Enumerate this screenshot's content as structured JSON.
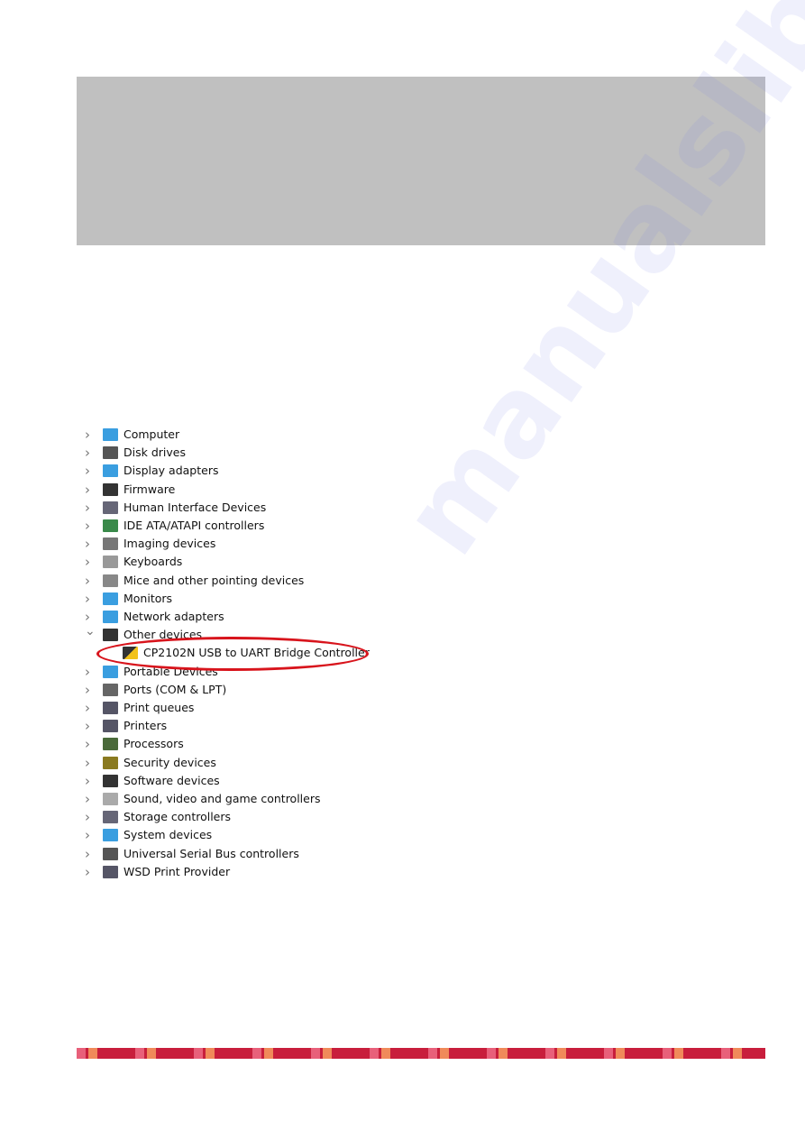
{
  "device_manager": {
    "items": [
      {
        "label": "Computer",
        "icon": "computer-icon",
        "expanded": false
      },
      {
        "label": "Disk drives",
        "icon": "disk-drive-icon",
        "expanded": false
      },
      {
        "label": "Display adapters",
        "icon": "display-adapter-icon",
        "expanded": false
      },
      {
        "label": "Firmware",
        "icon": "firmware-chip-icon",
        "expanded": false
      },
      {
        "label": "Human Interface Devices",
        "icon": "hid-icon",
        "expanded": false
      },
      {
        "label": "IDE ATA/ATAPI controllers",
        "icon": "ide-controller-icon",
        "expanded": false
      },
      {
        "label": "Imaging devices",
        "icon": "camera-icon",
        "expanded": false
      },
      {
        "label": "Keyboards",
        "icon": "keyboard-icon",
        "expanded": false
      },
      {
        "label": "Mice and other pointing devices",
        "icon": "mouse-icon",
        "expanded": false
      },
      {
        "label": "Monitors",
        "icon": "monitor-icon",
        "expanded": false
      },
      {
        "label": "Network adapters",
        "icon": "network-icon",
        "expanded": false
      },
      {
        "label": "Other devices",
        "icon": "unknown-device-icon",
        "expanded": true
      },
      {
        "label": "CP2102N USB to UART Bridge Controller",
        "icon": "warning-device-icon",
        "child": true
      },
      {
        "label": "Portable Devices",
        "icon": "portable-device-icon",
        "expanded": false
      },
      {
        "label": "Ports (COM & LPT)",
        "icon": "port-icon",
        "expanded": false
      },
      {
        "label": "Print queues",
        "icon": "printer-icon",
        "expanded": false
      },
      {
        "label": "Printers",
        "icon": "printer-icon",
        "expanded": false
      },
      {
        "label": "Processors",
        "icon": "processor-icon",
        "expanded": false
      },
      {
        "label": "Security devices",
        "icon": "security-device-icon",
        "expanded": false
      },
      {
        "label": "Software devices",
        "icon": "software-device-icon",
        "expanded": false
      },
      {
        "label": "Sound, video and game controllers",
        "icon": "speaker-icon",
        "expanded": false
      },
      {
        "label": "Storage controllers",
        "icon": "storage-controller-icon",
        "expanded": false
      },
      {
        "label": "System devices",
        "icon": "system-device-icon",
        "expanded": false
      },
      {
        "label": "Universal Serial Bus controllers",
        "icon": "usb-icon",
        "expanded": false
      },
      {
        "label": "WSD Print Provider",
        "icon": "printer-icon",
        "expanded": false
      }
    ]
  },
  "highlight_color": "#d8141c",
  "watermark": "manualslib",
  "colors": {
    "gray_box": "#c0c0c0",
    "footer_band": "#c81e3c"
  }
}
